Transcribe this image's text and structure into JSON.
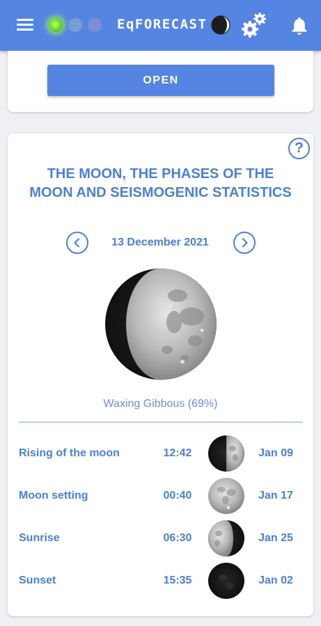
{
  "app": {
    "brand": "EqFORECAST",
    "icons": {
      "menu": "hamburger-menu-icon",
      "theme": "half-moon-icon",
      "settings": "gears-icon",
      "notifications": "bell-icon"
    },
    "status_lights": [
      "green",
      "yellow",
      "red"
    ],
    "active_light": "green"
  },
  "top_card": {
    "open_label": "OPEN"
  },
  "moon_card": {
    "help_label": "?",
    "title": "THE MOON, THE PHASES OF THE MOON AND SEISMOGENIC STATISTICS",
    "date": "13 December 2021",
    "phase_label": "Waxing Gibbous (69%)",
    "phase_illumination": 0.69,
    "rows": [
      {
        "label": "Rising of the moon",
        "time": "12:42",
        "phase_icon": "first-quarter-moon-icon",
        "date": "Jan 09"
      },
      {
        "label": "Moon setting",
        "time": "00:40",
        "phase_icon": "full-moon-icon",
        "date": "Jan 17"
      },
      {
        "label": "Sunrise",
        "time": "06:30",
        "phase_icon": "last-quarter-moon-icon",
        "date": "Jan 25"
      },
      {
        "label": "Sunset",
        "time": "15:35",
        "phase_icon": "new-moon-icon",
        "date": "Jan 02"
      }
    ]
  },
  "colors": {
    "header_bg": "#5585e3",
    "accent": "#4a7fd6",
    "phase_text": "#6b8fd0",
    "page_bg": "#eef0f3"
  }
}
